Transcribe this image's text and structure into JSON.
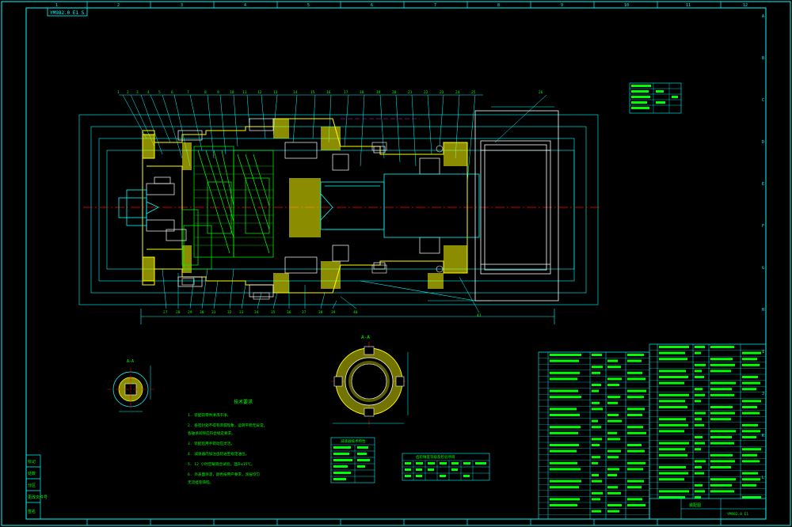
{
  "drawing": {
    "stamp_text": "YM982.0 E1 S",
    "section_label": "A-A",
    "section_label_small": "A-A",
    "tech_req_title": "技术要求",
    "tech_req_lines": [
      "1. 装配前零件清洗干净。",
      "2. 各密封处不得有渗漏现象，运转平稳无异常。",
      "   各轴承间隙应符合规定要求。",
      "3. 装配后用手转动应灵活。",
      "4. 减速器内加注齿轮油至规定油位。",
      "5. 12 小时空载跑合试验，温升≤15℃。",
      "6. 外表面涂漆，颜色按用户要求，涂层均匀",
      "   无流挂等缺陷。"
    ],
    "top_zone_numbers": [
      "1",
      "2",
      "3",
      "4",
      "5",
      "6",
      "7",
      "8",
      "9",
      "10",
      "11",
      "12"
    ],
    "side_zone_letters": [
      "A",
      "B",
      "C",
      "D",
      "E",
      "F",
      "G",
      "H",
      "I",
      "J",
      "K",
      "L"
    ],
    "left_table_labels": [
      "标记",
      "处数",
      "分区",
      "更改文件号",
      "签名"
    ],
    "param_table_title": "减速器技术特性",
    "gear_table_title": "齿轮精度等级及检验项目",
    "title_block_name": "装配图",
    "title_block_code": "YM982.0 E1"
  },
  "colors": {
    "frame": "#00ffff",
    "section_fill": "#ffff00",
    "centerline": "#ff0000",
    "text_green": "#00ff00",
    "hatch_green": "#00ff00",
    "white": "#ffffff",
    "magenta": "#ff00ff"
  }
}
